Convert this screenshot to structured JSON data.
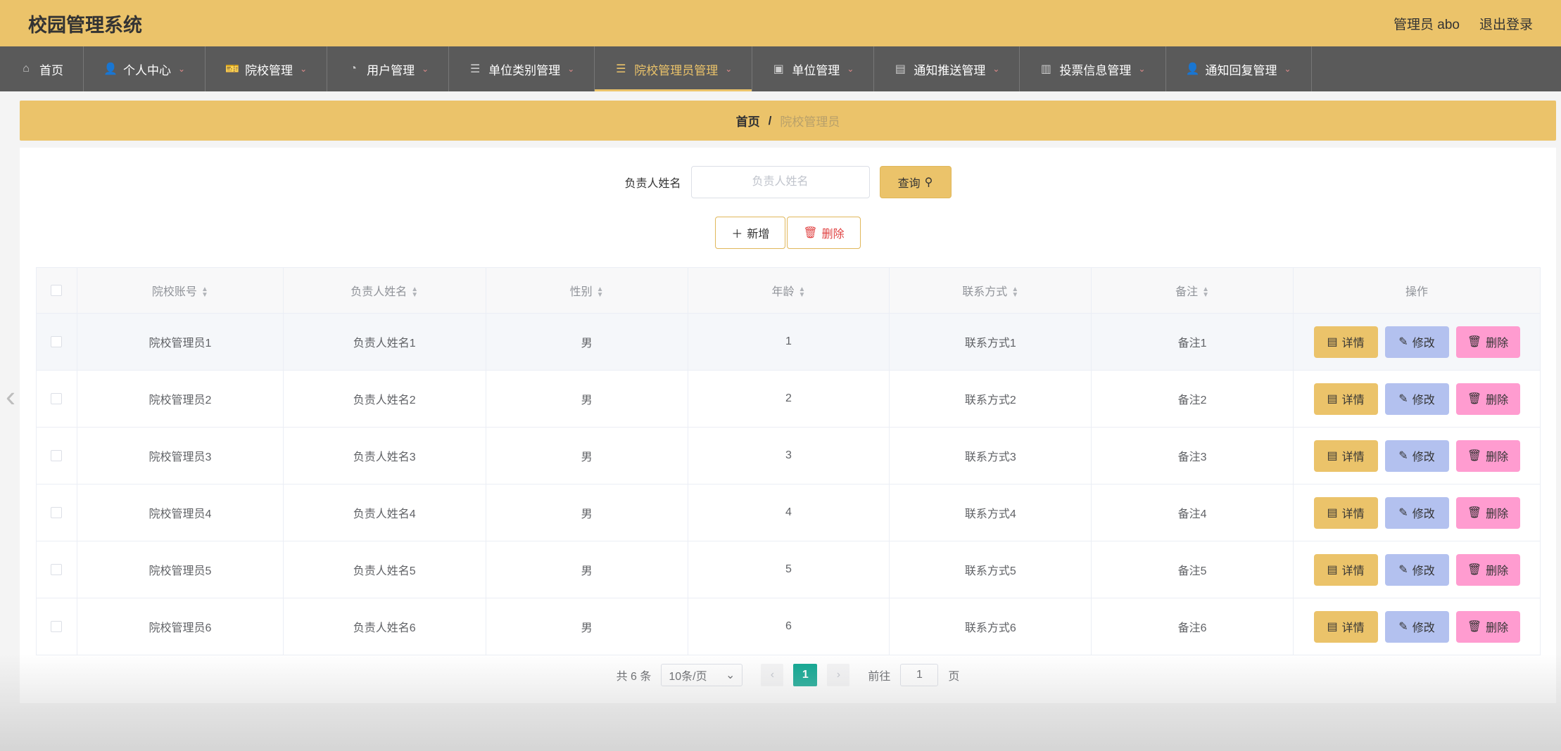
{
  "header": {
    "title": "校园管理系统",
    "user": "管理员 abo",
    "logout": "退出登录"
  },
  "nav": [
    {
      "label": "首页",
      "icon": "home-icon",
      "glyph": "⌂",
      "dropdown": false,
      "active": false
    },
    {
      "label": "个人中心",
      "icon": "user-icon",
      "glyph": "👤",
      "dropdown": true,
      "active": false
    },
    {
      "label": "院校管理",
      "icon": "ticket-icon",
      "glyph": "🎫",
      "dropdown": true,
      "active": false
    },
    {
      "label": "用户管理",
      "icon": "gauge-icon",
      "glyph": "◔",
      "dropdown": true,
      "active": false
    },
    {
      "label": "单位类别管理",
      "icon": "list-icon",
      "glyph": "☰",
      "dropdown": true,
      "active": false
    },
    {
      "label": "院校管理员管理",
      "icon": "menu-icon",
      "glyph": "☰",
      "dropdown": true,
      "active": true
    },
    {
      "label": "单位管理",
      "icon": "chart-icon",
      "glyph": "▣",
      "dropdown": true,
      "active": false
    },
    {
      "label": "通知推送管理",
      "icon": "briefcase-icon",
      "glyph": "▤",
      "dropdown": true,
      "active": false
    },
    {
      "label": "投票信息管理",
      "icon": "bar-chart-icon",
      "glyph": "▥",
      "dropdown": true,
      "active": false
    },
    {
      "label": "通知回复管理",
      "icon": "person-icon",
      "glyph": "👤",
      "dropdown": true,
      "active": false
    }
  ],
  "breadcrumb": {
    "home": "首页",
    "sep": "/",
    "current": "院校管理员"
  },
  "search": {
    "label": "负责人姓名",
    "placeholder": "负责人姓名",
    "button": "查询"
  },
  "actions": {
    "add": "新增",
    "delete": "删除"
  },
  "table": {
    "headers": [
      "院校账号",
      "负责人姓名",
      "性别",
      "年龄",
      "联系方式",
      "备注",
      "操作"
    ],
    "rows": [
      [
        "院校管理员1",
        "负责人姓名1",
        "男",
        "1",
        "联系方式1",
        "备注1"
      ],
      [
        "院校管理员2",
        "负责人姓名2",
        "男",
        "2",
        "联系方式2",
        "备注2"
      ],
      [
        "院校管理员3",
        "负责人姓名3",
        "男",
        "3",
        "联系方式3",
        "备注3"
      ],
      [
        "院校管理员4",
        "负责人姓名4",
        "男",
        "4",
        "联系方式4",
        "备注4"
      ],
      [
        "院校管理员5",
        "负责人姓名5",
        "男",
        "5",
        "联系方式5",
        "备注5"
      ],
      [
        "院校管理员6",
        "负责人姓名6",
        "男",
        "6",
        "联系方式6",
        "备注6"
      ]
    ],
    "ops": {
      "detail": "详情",
      "edit": "修改",
      "delete": "删除"
    }
  },
  "pager": {
    "total": "共 6 条",
    "size": "10条/页",
    "current": "1",
    "goto_prefix": "前往",
    "goto_value": "1",
    "goto_suffix": "页"
  },
  "colors": {
    "accent": "#ebc36a",
    "nav": "#5a5a5a",
    "page_active": "#0aa58f",
    "edit": "#b3c1ef",
    "delete": "#ff9cd0"
  }
}
